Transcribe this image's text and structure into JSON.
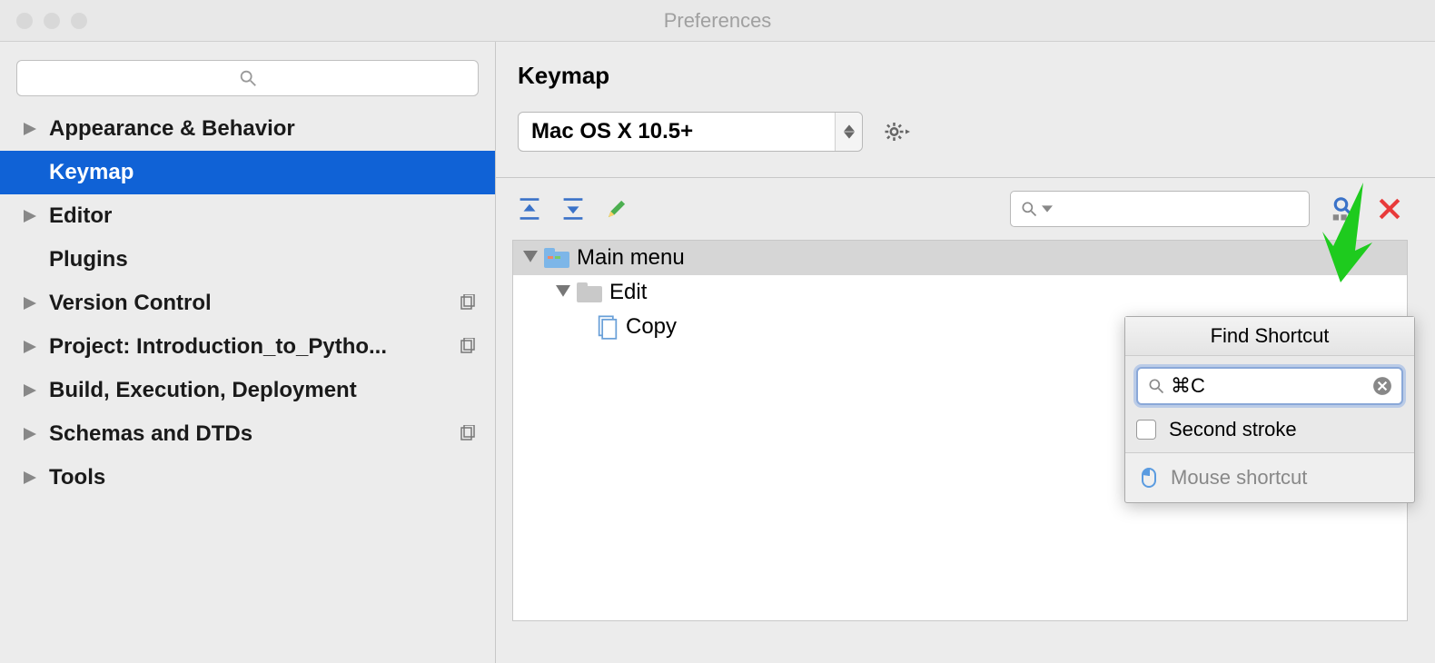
{
  "window": {
    "title": "Preferences"
  },
  "sidebar": {
    "search_placeholder": "",
    "items": [
      {
        "label": "Appearance & Behavior",
        "expandable": true,
        "copy": false
      },
      {
        "label": "Keymap",
        "expandable": false,
        "selected": true,
        "copy": false
      },
      {
        "label": "Editor",
        "expandable": true,
        "copy": false
      },
      {
        "label": "Plugins",
        "expandable": false,
        "copy": false
      },
      {
        "label": "Version Control",
        "expandable": true,
        "copy": true
      },
      {
        "label": "Project: Introduction_to_Pytho...",
        "expandable": true,
        "copy": true
      },
      {
        "label": "Build, Execution, Deployment",
        "expandable": true,
        "copy": false
      },
      {
        "label": "Schemas and DTDs",
        "expandable": true,
        "copy": true
      },
      {
        "label": "Tools",
        "expandable": true,
        "copy": false
      }
    ]
  },
  "main": {
    "title": "Keymap",
    "keymap_select_value": "Mac OS X 10.5+",
    "action_search_value": "",
    "tree": {
      "root": "Main menu",
      "child": "Edit",
      "leaf": "Copy"
    }
  },
  "popup": {
    "title": "Find Shortcut",
    "shortcut_value": "⌘C",
    "second_stroke_label": "Second stroke",
    "mouse_shortcut_label": "Mouse shortcut"
  }
}
